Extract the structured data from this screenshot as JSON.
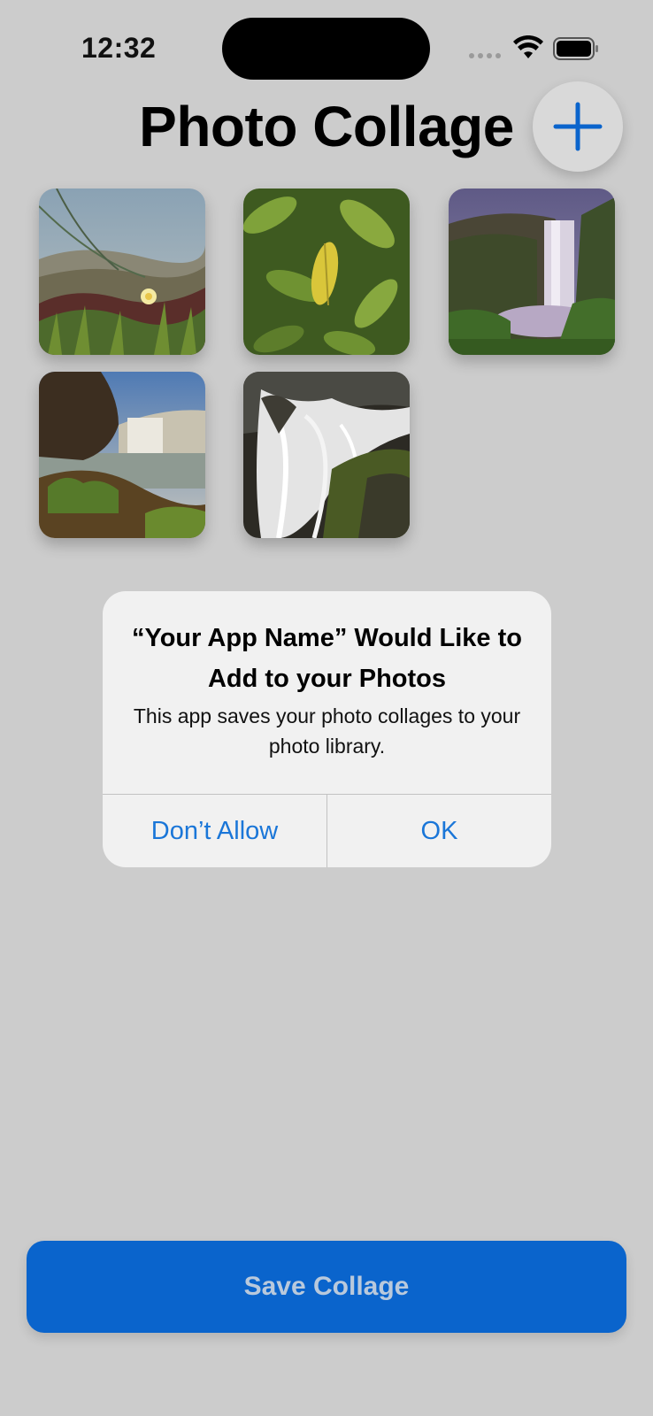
{
  "status_bar": {
    "time": "12:32",
    "wifi_icon": "wifi-icon",
    "battery_icon": "battery-icon"
  },
  "header": {
    "title": "Photo Collage",
    "add_icon": "plus-icon"
  },
  "photos": [
    {
      "subject": "dune grass and flowers"
    },
    {
      "subject": "green leaves"
    },
    {
      "subject": "waterfall cliff"
    },
    {
      "subject": "waterfall coast"
    },
    {
      "subject": "cascade rocks"
    }
  ],
  "alert": {
    "title": "“Your App Name” Would Like to Add to your Photos",
    "message": "This app saves your photo collages to your photo library.",
    "deny_label": "Don’t Allow",
    "ok_label": "OK"
  },
  "footer": {
    "save_label": "Save Collage"
  },
  "colors": {
    "background": "#cccccc",
    "accent": "#0a64cc",
    "alert_button_text": "#1a76d8"
  }
}
